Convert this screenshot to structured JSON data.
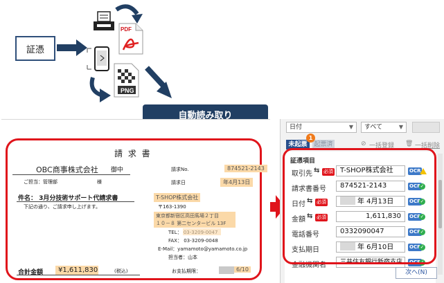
{
  "flow": {
    "source_label": "証憑",
    "pdf_label": "PDF",
    "png_label": "PNG",
    "banner": "自動読み取り"
  },
  "document": {
    "title": "請 求 書",
    "recipient": "OBC商事株式会社",
    "onchu": "御中",
    "contact": "ご担当：管理部",
    "sama": "様",
    "invoice_no_label": "請求No.",
    "invoice_no": "874521-2143",
    "invoice_date_label": "請求日",
    "invoice_date": "年4月13日",
    "subject": "件名： 3月分技術サポート代請求書",
    "note": "下記の通り、ご請求申し上げます。",
    "vendor": "T-SHOP株式会社",
    "zip": "〒163-1390",
    "address1": "東京都新宿区高田馬場２丁目",
    "address2": "１０－８ 第二センタービル 13F",
    "tel": "TEL： 03-3209-0047",
    "fax": "FAX： 03-3209-0048",
    "email": "E-Mail：yamamoto@yamamoto.co.jp",
    "staff": "担当者：山本",
    "total_label": "合計金額",
    "total": "¥1,611,830",
    "tax": "(税込)",
    "due_label": "お支払期限：",
    "due": "6/10"
  },
  "app": {
    "filter_date": "日付",
    "filter_all": "すべて",
    "tab_unregistered": "未起票",
    "tab_registered": "起票済",
    "badge_count": "1",
    "bulk_register": "一括登録",
    "bulk_delete": "一括削除",
    "section_title": "証憑項目",
    "ocr": "OCR",
    "required": "必須",
    "next_button": "次へ(N)",
    "fields": [
      {
        "label": "取引先",
        "value": "T-SHOP株式会社"
      },
      {
        "label": "請求書番号",
        "value": "874521-2143"
      },
      {
        "label": "日付",
        "value": "年 4月13日"
      },
      {
        "label": "金額",
        "value": "1,611,830"
      },
      {
        "label": "電話番号",
        "value": "0332090047"
      },
      {
        "label": "支払期日",
        "value": "年 6月10日"
      },
      {
        "label": "金融機関名",
        "value": "三井住友銀行新宿支店"
      }
    ]
  },
  "colors": {
    "navy": "#213f63",
    "red": "#e0141b",
    "highlight": "#fbd9a8",
    "ocr_blue": "#3d79c8",
    "ok_green": "#2fae4e"
  }
}
